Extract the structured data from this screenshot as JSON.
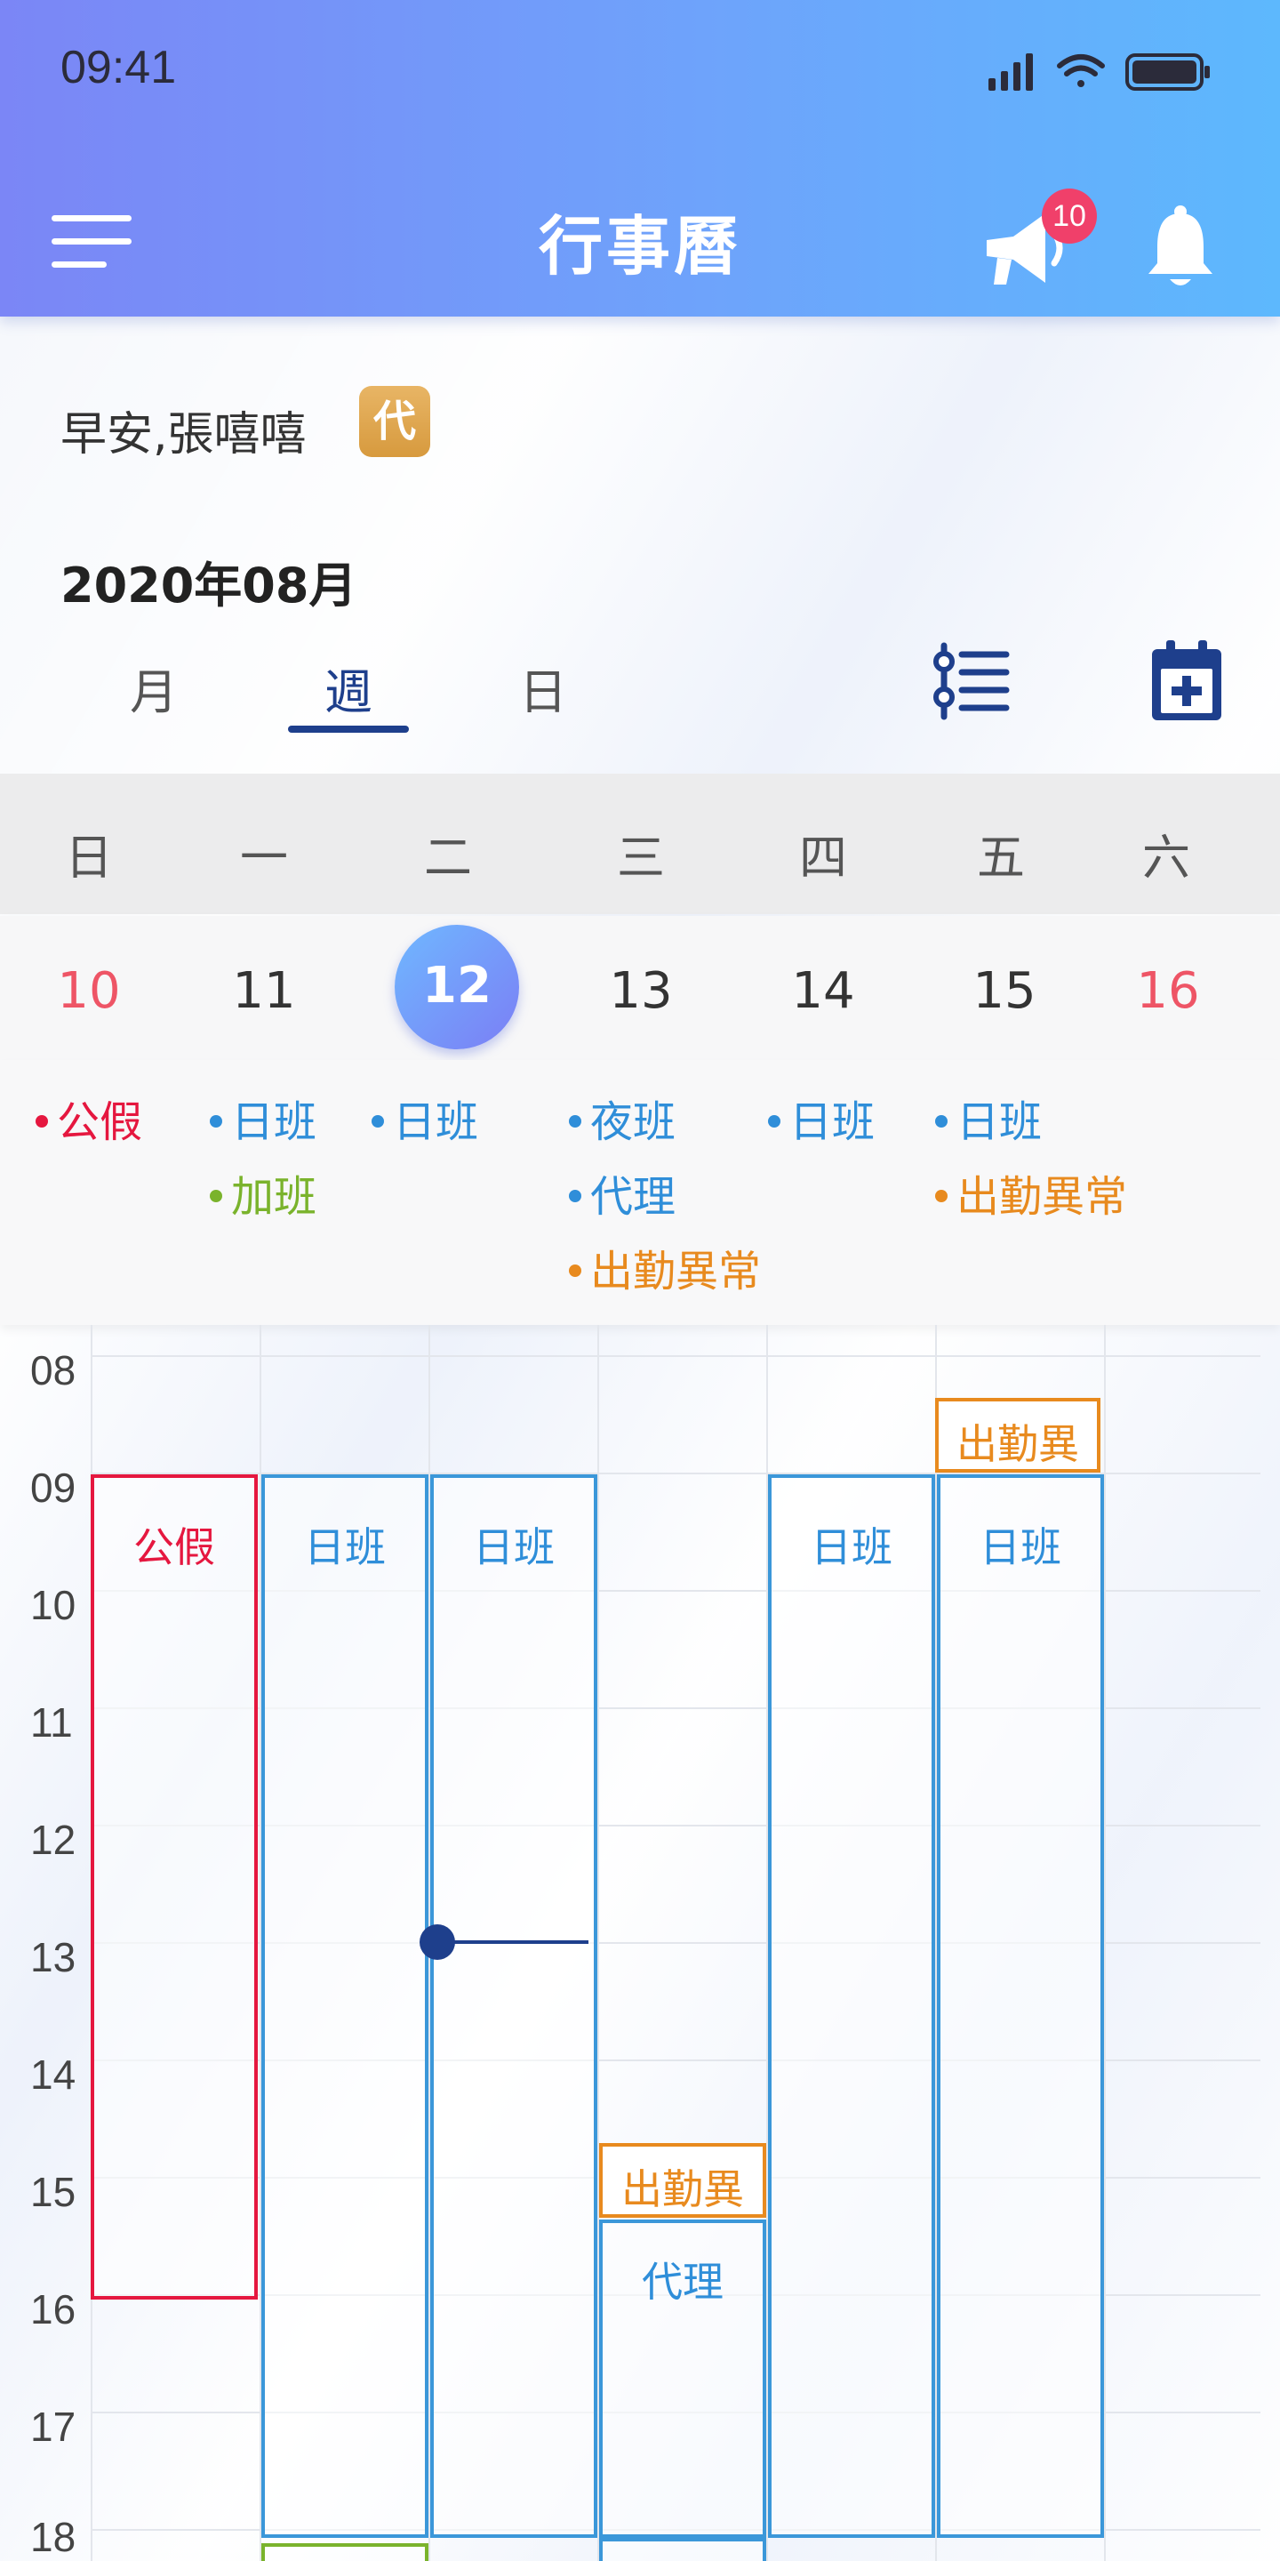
{
  "status_bar": {
    "time": "09:41"
  },
  "header": {
    "title": "行事曆",
    "announcement_count": "10"
  },
  "greeting": {
    "text": "早安,張嘻嘻",
    "proxy_badge": "代"
  },
  "month_title": "2020年08月",
  "view_tabs": [
    {
      "label": "月",
      "active": false
    },
    {
      "label": "週",
      "active": true
    },
    {
      "label": "日",
      "active": false
    }
  ],
  "weekdays": [
    "日",
    "一",
    "二",
    "三",
    "四",
    "五",
    "六"
  ],
  "dates": [
    "10",
    "11",
    "12",
    "13",
    "14",
    "15",
    "16"
  ],
  "today_index": 2,
  "day_events": [
    [
      "公假"
    ],
    [
      "日班",
      "加班"
    ],
    [
      "日班"
    ],
    [
      "夜班",
      "代理",
      "出勤異常"
    ],
    [
      "日班"
    ],
    [
      "日班",
      "出勤異常"
    ],
    []
  ],
  "hours": [
    "08",
    "09",
    "10",
    "11",
    "12",
    "13",
    "14",
    "15",
    "16",
    "17",
    "18"
  ],
  "timeline_blocks": [
    {
      "label": "公假",
      "color": "red"
    },
    {
      "label": "日班",
      "color": "blue"
    },
    {
      "label": "日班",
      "color": "blue"
    },
    {
      "label": "日班",
      "color": "blue"
    },
    {
      "label": "日班",
      "color": "blue"
    },
    {
      "label": "出勤異",
      "color": "orange"
    },
    {
      "label": "出勤異",
      "color": "orange"
    },
    {
      "label": "代理",
      "color": "blue"
    },
    {
      "label": "",
      "color": "green"
    }
  ],
  "colors": {
    "accent_navy": "#1e3f8c",
    "holiday_red": "#e5173f",
    "shift_blue": "#2f8ed9",
    "overtime_green": "#7ab32c",
    "anomaly_orange": "#e88a1e",
    "weekend_red": "#ee5566",
    "proxy_gold": "#d79a3e",
    "badge_pink": "#f0406a"
  },
  "icons": [
    "menu-icon",
    "megaphone-icon",
    "bell-icon",
    "list-filter-icon",
    "calendar-add-icon",
    "signal-icon",
    "wifi-icon",
    "battery-icon"
  ]
}
